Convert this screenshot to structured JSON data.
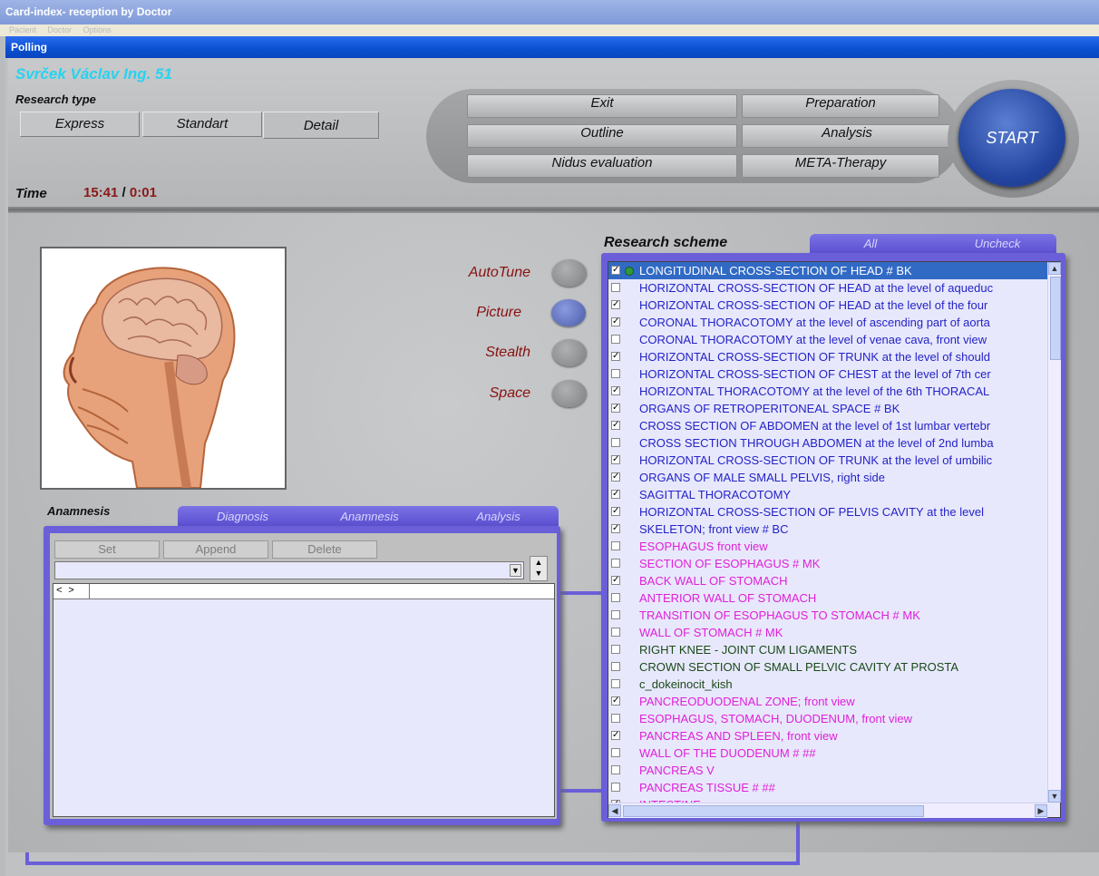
{
  "outer_window": {
    "title": "Card-index- reception by Doctor",
    "menu": [
      "Pacient",
      "Doctor",
      "Options"
    ]
  },
  "window": {
    "title": "Polling"
  },
  "patient": {
    "name": "Svrček Václav Ing.  51"
  },
  "research_type": {
    "label": "Research type",
    "options": [
      "Express",
      "Standart",
      "Detail"
    ]
  },
  "actions": {
    "exit": "Exit",
    "outline": "Outline",
    "nidus": "Nidus evaluation",
    "preparation": "Preparation",
    "analysis": "Analysis",
    "meta": "META-Therapy",
    "start": "START"
  },
  "time": {
    "label": "Time",
    "clock": "15:41",
    "separator": " / ",
    "elapsed": "0:01"
  },
  "modes": [
    {
      "label": "AutoTune",
      "active": false
    },
    {
      "label": "Picture",
      "active": true
    },
    {
      "label": "Stealth",
      "active": false
    },
    {
      "label": "Space",
      "active": false
    }
  ],
  "anamnesis": {
    "title": "Anamnesis",
    "tabs": [
      "Diagnosis",
      "Anamnesis",
      "Analysis"
    ],
    "buttons": {
      "set": "Set",
      "append": "Append",
      "delete": "Delete"
    },
    "nav": "<  >"
  },
  "research_scheme": {
    "title": "Research scheme",
    "tabs": {
      "all": "All",
      "uncheck": "Uncheck"
    },
    "colors": {
      "green": "#2a6a2a",
      "blue": "#2323c8",
      "magenta": "#e020d8",
      "dark": "#1a4a1a"
    },
    "items": [
      {
        "text": "LONGITUDINAL CROSS-SECTION OF HEAD # BK",
        "checked": true,
        "color": "sel",
        "selected": true
      },
      {
        "text": "HORIZONTAL CROSS-SECTION OF HEAD at the level of aqueduc",
        "checked": false,
        "color": "blue"
      },
      {
        "text": "HORIZONTAL CROSS-SECTION OF HEAD at the level of the four",
        "checked": true,
        "color": "blue"
      },
      {
        "text": "CORONAL THORACOTOMY at the level of ascending part of aorta",
        "checked": true,
        "color": "blue"
      },
      {
        "text": "CORONAL THORACOTOMY at the level of venae cava, front view",
        "checked": false,
        "color": "blue"
      },
      {
        "text": "HORIZONTAL CROSS-SECTION OF TRUNK at the level of should",
        "checked": true,
        "color": "blue"
      },
      {
        "text": "HORIZONTAL CROSS-SECTION OF CHEST at the level of 7th cer",
        "checked": false,
        "color": "blue"
      },
      {
        "text": "HORIZONTAL THORACOTOMY at the level of the 6th THORACAL",
        "checked": true,
        "color": "blue"
      },
      {
        "text": "ORGANS OF RETROPERITONEAL SPACE # BK",
        "checked": true,
        "color": "blue"
      },
      {
        "text": "CROSS SECTION OF ABDOMEN at the level of 1st lumbar vertebr",
        "checked": true,
        "color": "blue"
      },
      {
        "text": "CROSS SECTION THROUGH ABDOMEN at the level of 2nd lumba",
        "checked": false,
        "color": "blue"
      },
      {
        "text": "HORIZONTAL CROSS-SECTION OF TRUNK at the level of umbilic",
        "checked": true,
        "color": "blue"
      },
      {
        "text": "ORGANS OF MALE SMALL PELVIS, right side",
        "checked": true,
        "color": "blue"
      },
      {
        "text": "SAGITTAL THORACOTOMY",
        "checked": true,
        "color": "blue"
      },
      {
        "text": "HORIZONTAL CROSS-SECTION OF PELVIS CAVITY at the level",
        "checked": true,
        "color": "blue"
      },
      {
        "text": "SKELETON;  front  view # BC",
        "checked": true,
        "color": "blue"
      },
      {
        "text": "ESOPHAGUS    front  view",
        "checked": false,
        "color": "magenta"
      },
      {
        "text": "SECTION OF ESOPHAGUS # MK",
        "checked": false,
        "color": "magenta"
      },
      {
        "text": "BACK WALL OF STOMACH",
        "checked": true,
        "color": "magenta"
      },
      {
        "text": "ANTERIOR  WALL  OF  STOMACH",
        "checked": false,
        "color": "magenta"
      },
      {
        "text": "TRANSITION OF ESOPHAGUS TO STOMACH # MK",
        "checked": false,
        "color": "magenta"
      },
      {
        "text": "WALL OF STOMACH  # MK",
        "checked": false,
        "color": "magenta"
      },
      {
        "text": "RIGHT  KNEE - JOINT  CUM  LIGAMENTS",
        "checked": false,
        "color": "dark"
      },
      {
        "text": "CROWN  SECTION  OF  SMALL  PELVIC  CAVITY  AT  PROSTA",
        "checked": false,
        "color": "dark"
      },
      {
        "text": "c_dokeinocit_kish",
        "checked": false,
        "color": "dark"
      },
      {
        "text": "PANCREODUODENAL  ZONE;  front  view",
        "checked": true,
        "color": "magenta"
      },
      {
        "text": "ESOPHAGUS,  STOMACH,  DUODENUM,  front  view",
        "checked": false,
        "color": "magenta"
      },
      {
        "text": "PANCREAS  AND  SPLEEN,  front  view",
        "checked": true,
        "color": "magenta"
      },
      {
        "text": "WALL  OF  THE  DUODENUM # ##",
        "checked": false,
        "color": "magenta"
      },
      {
        "text": "PANCREAS  V",
        "checked": false,
        "color": "magenta"
      },
      {
        "text": "PANCREAS  TISSUE # ##",
        "checked": false,
        "color": "magenta"
      },
      {
        "text": "INTESTINE",
        "checked": true,
        "color": "magenta"
      }
    ]
  }
}
